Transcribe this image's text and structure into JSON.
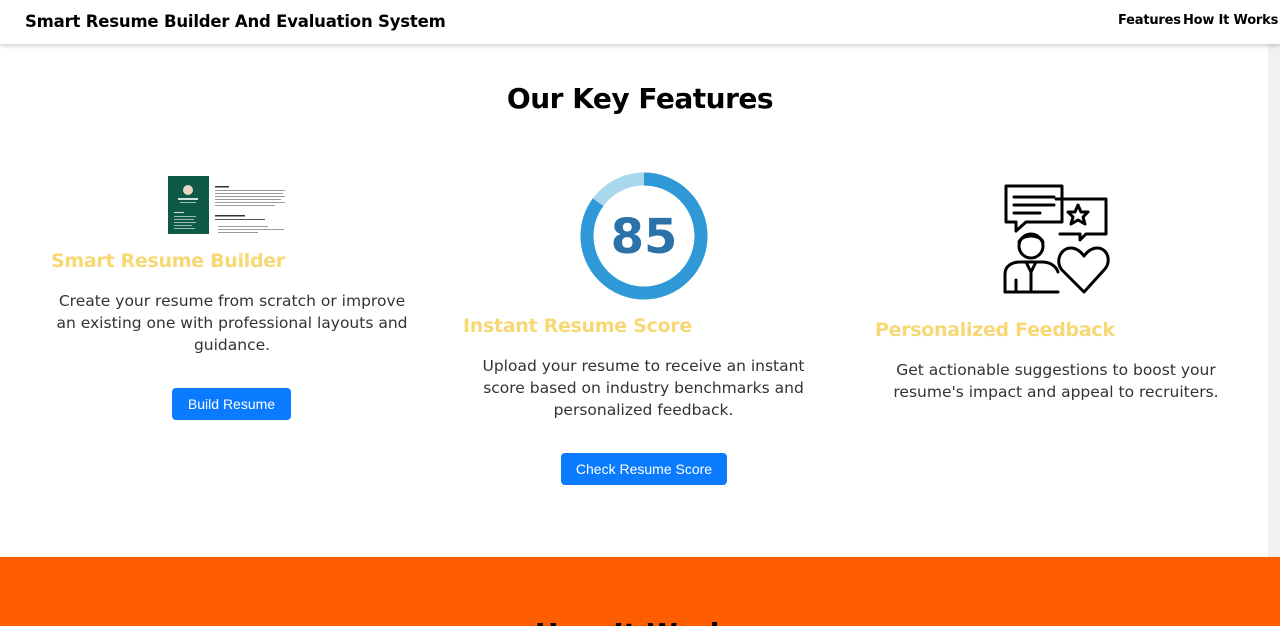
{
  "navbar": {
    "brand": "Smart Resume Builder And Evaluation System",
    "links": [
      "Features",
      "How It Works"
    ]
  },
  "features": {
    "title": "Our Key Features",
    "items": [
      {
        "title": "Smart Resume Builder",
        "description": "Create your resume from scratch or improve an existing one with professional layouts and guidance.",
        "button": "Build Resume",
        "icon": "resume-thumbnail"
      },
      {
        "title": "Instant Resume Score",
        "description": "Upload your resume to receive an instant score based on industry benchmarks and personalized feedback.",
        "button": "Check Resume Score",
        "icon": "score-ring",
        "score": "85",
        "score_fraction": 0.85
      },
      {
        "title": "Personalized Feedback",
        "description": "Get actionable suggestions to boost your resume's impact and appeal to recruiters.",
        "icon": "feedback-person-icon"
      }
    ]
  },
  "how_it_works": {
    "title": "How It Works"
  },
  "colors": {
    "accent_yellow": "#f7d875",
    "button_blue": "#0a7bff",
    "orange_band": "#ff5e00",
    "ring_dark": "#2f98d6",
    "ring_light": "#a9d8ee",
    "score_text": "#2a72a8"
  }
}
